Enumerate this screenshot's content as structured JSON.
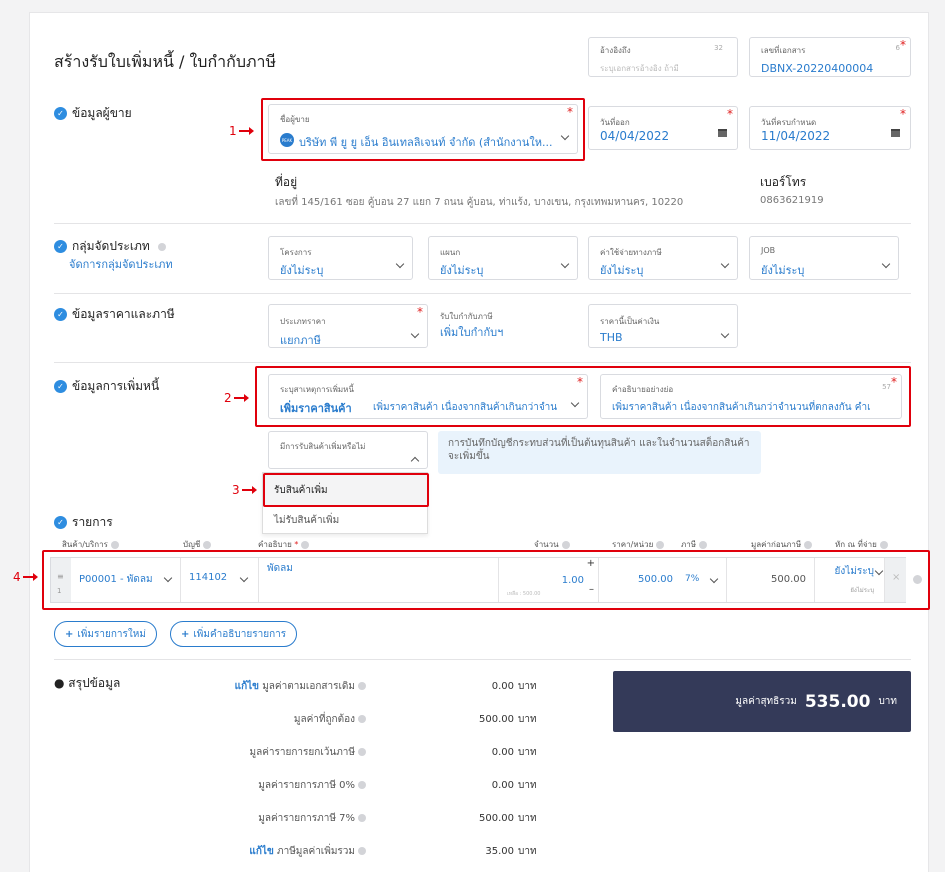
{
  "page_title": "สร้างรับใบเพิ่มหนี้ / ใบกำกับภาษี",
  "header_fields": {
    "reference": {
      "label": "อ้างอิงถึง",
      "count": "32",
      "placeholder": "ระบุเอกสารอ้างอิง ถ้ามี"
    },
    "doc_number": {
      "label": "เลขที่เอกสาร",
      "count": "6",
      "value": "DBNX-20220400004"
    }
  },
  "seller": {
    "section": "ข้อมูลผู้ขาย",
    "name_label": "ชื่อผู้ขาย",
    "avatar": "PEAK",
    "name_value": "บริษัท พี ยู ยู เอ็น อินเทลลิเจนท์ จำกัด (สำนักงานให...",
    "issue_label": "วันที่ออก",
    "issue_value": "04/04/2022",
    "due_label": "วันที่ครบกำหนด",
    "due_value": "11/04/2022",
    "address_label": "ที่อยู่",
    "address_value": "เลขที่ 145/161 ซอย คู้บอน 27 แยก 7 ถนน คู้บอน, ท่าแร้ง, บางเขน, กรุงเทพมหานคร, 10220",
    "phone_label": "เบอร์โทร",
    "phone_value": "0863621919"
  },
  "category": {
    "section": "กลุ่มจัดประเภท",
    "manage_link": "จัดการกลุ่มจัดประเภท",
    "fields": [
      {
        "label": "โครงการ",
        "value": "ยังไม่ระบุ"
      },
      {
        "label": "แผนก",
        "value": "ยังไม่ระบุ"
      },
      {
        "label": "ค่าใช้จ่ายทางภาษี",
        "value": "ยังไม่ระบุ"
      },
      {
        "label": "JOB",
        "value": "ยังไม่ระบุ"
      }
    ]
  },
  "pricing": {
    "section": "ข้อมูลราคาและภาษี",
    "price_type_label": "ประเภทราคา",
    "price_type_value": "แยกภาษี",
    "tax_invoice_label": "รับใบกำกับภาษี",
    "tax_invoice_value": "เพิ่มใบกำกับฯ",
    "currency_label": "ราคานี้เป็นค่าเงิน",
    "currency_value": "THB"
  },
  "debit": {
    "section": "ข้อมูลการเพิ่มหนี้",
    "reason_label": "ระบุสาเหตุการเพิ่มหนี้",
    "reason_bold": "เพิ่มราคาสินค้า",
    "reason_rest": "เพิ่มราคาสินค้า เนื่องจากสินค้าเกินกว่าจำน...",
    "desc_label": "คำอธิบายอย่างย่อ",
    "desc_count": "57",
    "desc_value": "เพิ่มราคาสินค้า เนื่องจากสินค้าเกินกว่าจำนวนที่ตกลงกัน คำเ",
    "receive_label": "มีการรับสินค้าเพิ่มหรือไม่",
    "hint": "การบันทึกบัญชีกระทบส่วนที่เป็นต้นทุนสินค้า และในจำนวนสต็อกสินค้าจะเพิ่มขึ้น",
    "options": [
      "รับสินค้าเพิ่ม",
      "ไม่รับสินค้าเพิ่ม"
    ]
  },
  "items": {
    "section": "รายการ",
    "headers": {
      "product": "สินค้า/บริการ",
      "account": "บัญชี",
      "desc": "คำอธิบาย",
      "qty": "จำนวน",
      "unit_price": "ราคา/หน่วย",
      "tax": "ภาษี",
      "pretax": "มูลค่าก่อนภาษี",
      "withholding": "หัก ณ ที่จ่าย"
    },
    "row": {
      "index": "1",
      "product": "P00001 - พัดลม",
      "account": "114102",
      "desc": "พัดลม",
      "qty": "1.00",
      "remaining": "เหลือ : 500.00",
      "unit_price": "500.00",
      "tax": "7%",
      "pretax": "500.00",
      "withholding": "ยังไม่ระบุ",
      "withholding_sub": "ยังไม่ระบุ"
    },
    "add_row": "เพิ่มรายการใหม่",
    "add_desc": "เพิ่มคำอธิบายรายการ"
  },
  "summary": {
    "section": "สรุปข้อมูล",
    "lines": [
      {
        "link": "แก้ไข",
        "label": "มูลค่าตามเอกสารเดิม",
        "value": "0.00",
        "unit": "บาท"
      },
      {
        "link": "",
        "label": "มูลค่าที่ถูกต้อง",
        "value": "500.00",
        "unit": "บาท"
      },
      {
        "link": "",
        "label": "มูลค่ารายการยกเว้นภาษี",
        "value": "0.00",
        "unit": "บาท"
      },
      {
        "link": "",
        "label": "มูลค่ารายการภาษี 0%",
        "value": "0.00",
        "unit": "บาท"
      },
      {
        "link": "",
        "label": "มูลค่ารายการภาษี 7%",
        "value": "500.00",
        "unit": "บาท"
      },
      {
        "link": "แก้ไข",
        "label": "ภาษีมูลค่าเพิ่มรวม",
        "value": "35.00",
        "unit": "บาท"
      }
    ],
    "net_label": "มูลค่าสุทธิรวม",
    "net_value": "535.00",
    "net_unit": "บาท"
  },
  "annotations": [
    "1",
    "2",
    "3",
    "4"
  ],
  "colors": {
    "accent": "#2a7ccd",
    "highlight": "#e0000c",
    "total_bg": "#343a59"
  }
}
